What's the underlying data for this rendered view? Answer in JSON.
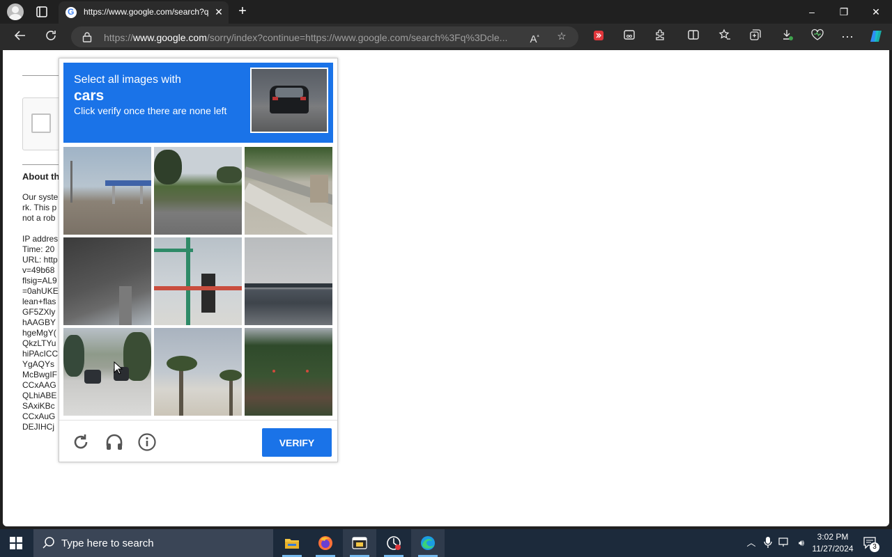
{
  "browser": {
    "tab_title": "https://www.google.com/search?q",
    "url_prefix": "https://",
    "url_domain": "www.google.com",
    "url_rest": "/sorry/index?continue=https://www.google.com/search%3Fq%3Dcle...",
    "window_controls": {
      "minimize": "–",
      "restore": "❐",
      "close": "✕"
    },
    "new_tab_label": "+"
  },
  "page": {
    "about_heading": "About th",
    "background_lines": [
      "Our syste",
      "rk. This p",
      "not a rob",
      "",
      "IP addres",
      "Time: 20",
      "URL: http",
      "v=49b68",
      "flsig=AL9",
      "=0ahUKE",
      "lean+flas",
      "GF5ZXly",
      "hAAGBY",
      "hgeMgY(",
      "QkzLTYu",
      "hiPAcICC",
      "YgAQYs",
      "McBwgIF",
      "CCxAAG",
      "QLhiABE",
      "SAxiKBc",
      "CCxAuG",
      "DEJIHCj"
    ]
  },
  "captcha": {
    "instruction_line1": "Select all images with",
    "target": "cars",
    "instruction_line3": "Click verify once there are none left",
    "tiles": [
      {
        "name": "tile-gas-station"
      },
      {
        "name": "tile-road-trees"
      },
      {
        "name": "tile-guardrail"
      },
      {
        "name": "tile-overpass"
      },
      {
        "name": "tile-traffic-light"
      },
      {
        "name": "tile-bridge"
      },
      {
        "name": "tile-road-cars"
      },
      {
        "name": "tile-palm-trees"
      },
      {
        "name": "tile-traffic-lights-trees"
      }
    ],
    "verify_label": "VERIFY"
  },
  "taskbar": {
    "search_placeholder": "Type here to search",
    "time": "3:02 PM",
    "date": "11/27/2024",
    "notification_count": "3"
  },
  "colors": {
    "accent": "#1a73e8",
    "taskbar": "#1c2a3b"
  }
}
